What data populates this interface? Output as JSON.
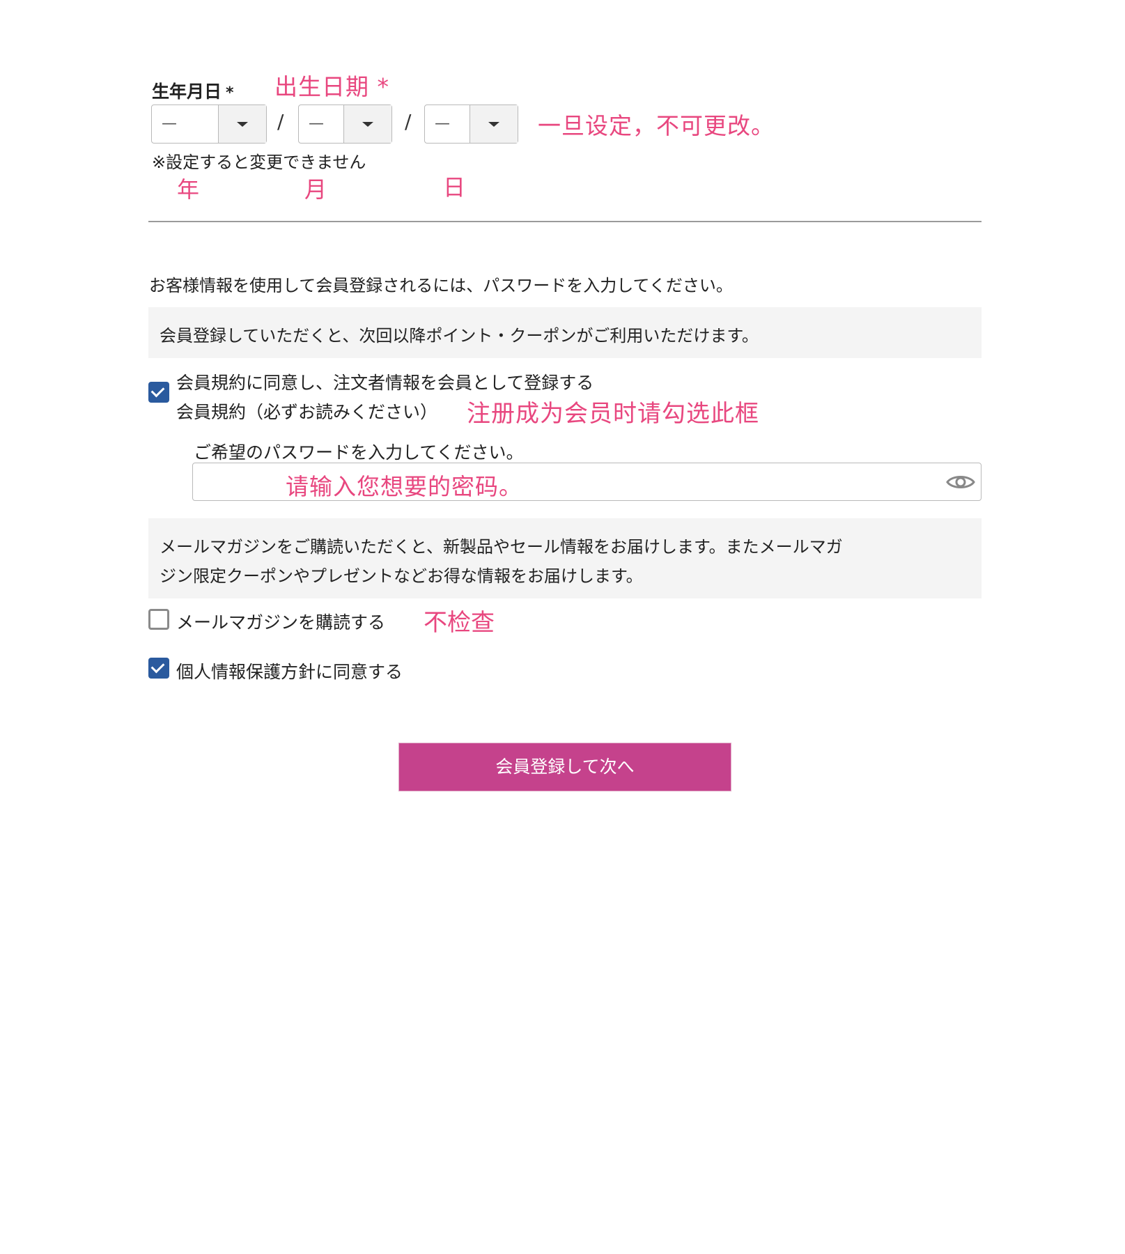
{
  "birthdate": {
    "label": "生年月日",
    "required_mark": "*",
    "year_value": "—",
    "month_value": "—",
    "day_value": "—",
    "separator": "/",
    "note": "※設定すると変更できません"
  },
  "annotations": {
    "birthdate": "出生日期 *",
    "no_change": "一旦设定，不可更改。",
    "year": "年",
    "month": "月",
    "day": "日",
    "check_member": "注册成为会员时请勾选此框",
    "password": "请输入您想要的密码。",
    "no_check": "不检查"
  },
  "registration": {
    "intro": "お客様情報を使用して会員登録されるには、パスワードを入力してください。",
    "benefit": "会員登録していただくと、次回以降ポイント・クーポンがご利用いただけます。",
    "terms_checkbox_line1": "会員規約に同意し、注文者情報を会員として登録する",
    "terms_checkbox_line2": "会員規約（必ずお読みください）",
    "terms_checked": true,
    "password_label": "ご希望のパスワードを入力してください。",
    "password_value": ""
  },
  "newsletter": {
    "info_line1": "メールマガジンをご購読いただくと、新製品やセール情報をお届けします。またメールマガ",
    "info_line2": "ジン限定クーポンやプレゼントなどお得な情報をお届けします。",
    "checkbox_label": "メールマガジンを購読する",
    "checked": false
  },
  "privacy": {
    "checkbox_label": "個人情報保護方針に同意する",
    "checked": true
  },
  "submit_label": "会員登録して次へ",
  "colors": {
    "annotation": "#e8477f",
    "checkbox": "#2a5a9e",
    "submit": "#c5428c"
  }
}
